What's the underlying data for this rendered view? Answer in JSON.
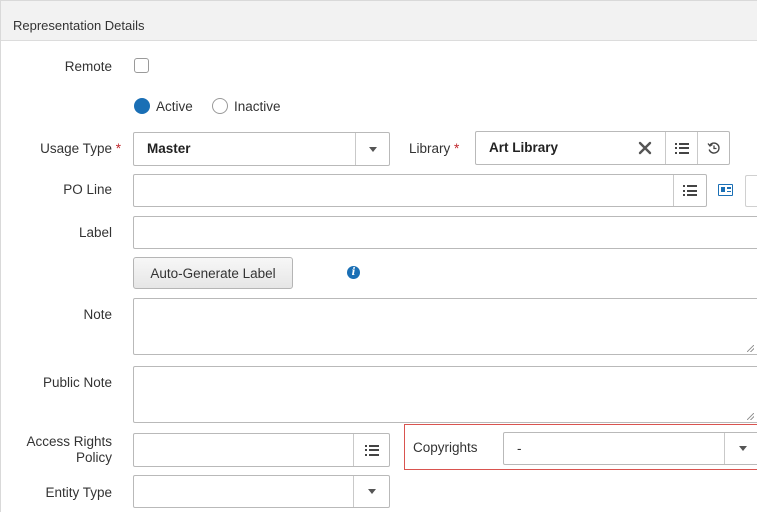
{
  "section": {
    "title": "Representation Details"
  },
  "remote": {
    "label": "Remote",
    "checked": false
  },
  "status": {
    "active_label": "Active",
    "inactive_label": "Inactive",
    "selected": "Active"
  },
  "usage_type": {
    "label": "Usage Type",
    "required": "*",
    "value": "Master"
  },
  "library": {
    "label": "Library",
    "required": "*",
    "value": "Art Library"
  },
  "po_line": {
    "label": "PO Line",
    "value": ""
  },
  "label_field": {
    "label": "Label",
    "value": ""
  },
  "auto_generate": {
    "button_label": "Auto-Generate Label"
  },
  "note": {
    "label": "Note",
    "value": ""
  },
  "public_note": {
    "label": "Public Note",
    "value": ""
  },
  "access_rights": {
    "label_line1": "Access Rights",
    "label_line2": "Policy",
    "value": ""
  },
  "copyrights": {
    "label": "Copyrights",
    "value": "-"
  },
  "entity_type": {
    "label": "Entity Type",
    "value": ""
  },
  "colors": {
    "accent": "#1a6fb5",
    "required": "#c0282d",
    "error_border": "#d9534f"
  }
}
